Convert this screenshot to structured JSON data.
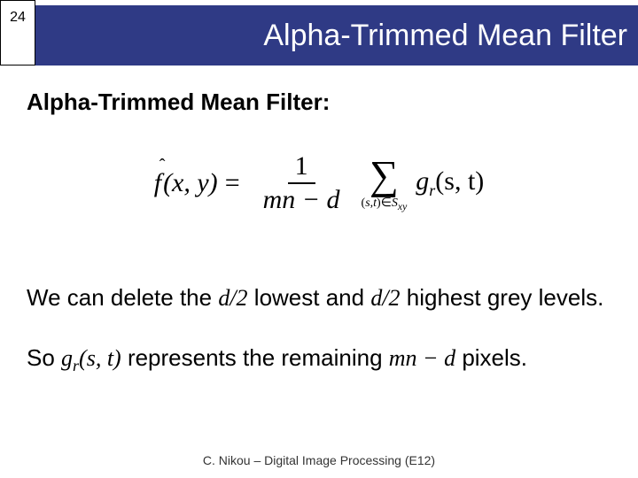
{
  "page_number": "24",
  "title": "Alpha-Trimmed Mean Filter",
  "subtitle": "Alpha-Trimmed Mean Filter:",
  "formula": {
    "lhs_f": "f",
    "lhs_args": "(x, y)",
    "eq": "=",
    "frac_num": "1",
    "frac_den": "mn − d",
    "sigma": "∑",
    "sum_sub_pre": "(",
    "sum_sub_s": "s",
    "sum_sub_comma": ",",
    "sum_sub_t": "t",
    "sum_sub_post": ")∈",
    "sum_sub_S": "S",
    "sum_sub_xy": "xy",
    "g": "g",
    "g_sub": "r",
    "g_args": "(s, t)"
  },
  "body": {
    "line1_a": "We can delete the ",
    "line1_d2a": "d/2",
    "line1_b": " lowest and ",
    "line1_d2b": "d/2",
    "line1_c": " highest grey levels.",
    "line2_a": "So ",
    "line2_gr": "g",
    "line2_gr_sub": "r",
    "line2_gr_args": "(s, t)",
    "line2_b": " represents the remaining ",
    "line2_mnd": "mn − d",
    "line2_c": " pixels."
  },
  "footer": "C. Nikou – Digital Image Processing (E12)"
}
